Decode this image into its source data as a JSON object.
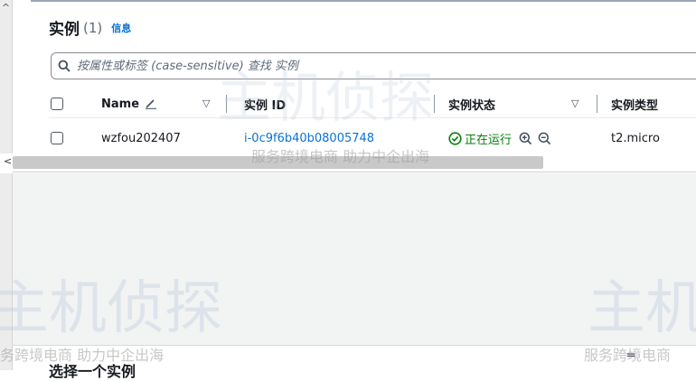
{
  "header": {
    "title": "实例",
    "count": "(1)",
    "info_link": "信息"
  },
  "search": {
    "placeholder": "按属性或标签 (case-sensitive) 查找 实例"
  },
  "columns": {
    "name": "Name",
    "instance_id": "实例 ID",
    "instance_state": "实例状态",
    "instance_type": "实例类型"
  },
  "rows": [
    {
      "name": "wzfou202407",
      "instance_id": "i-0c9f6b40b08005748",
      "state": "正在运行",
      "type": "t2.micro"
    }
  ],
  "bottom_panel": {
    "title": "选择一个实例"
  },
  "watermark": {
    "brand": "主机侦探",
    "tagline": "服务跨境电商 助力中企出海",
    "tagline_left": "务跨境电商 助力中企出海",
    "tagline_right": "服务跨境电商",
    "brand_left": "主机侦探",
    "brand_right": "主机"
  },
  "colors": {
    "link": "#0972d3",
    "running": "#037f0c",
    "text": "#16191f",
    "muted": "#5f6b7a"
  }
}
